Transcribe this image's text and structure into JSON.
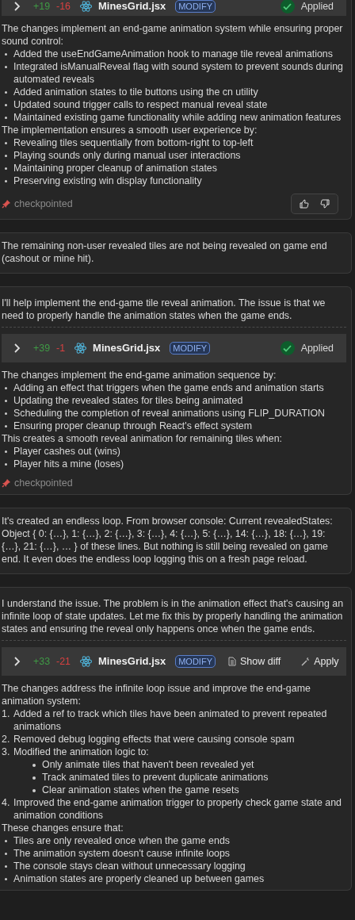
{
  "messages": [
    {
      "kind": "assistant",
      "cut_top": true,
      "file": {
        "added": "+19",
        "removed": "-16",
        "name": "MinesGrid.jsx",
        "badge": "MODIFY",
        "actions": [
          {
            "kind": "status",
            "label": "Applied"
          }
        ]
      },
      "body": [
        {
          "kind": "para",
          "text": "The changes implement an end-game animation system while ensuring proper sound control:"
        },
        {
          "kind": "bullets",
          "items": [
            {
              "text": "Added the useEndGameAnimation hook to manage tile reveal animations"
            },
            {
              "text": "Integrated isManualReveal flag with sound system to prevent sounds during automated reveals"
            },
            {
              "text": "Added animation states to tile buttons using the cn utility"
            },
            {
              "text": "Updated sound trigger calls to respect manual reveal state"
            },
            {
              "text": "Maintained existing game functionality while adding new animation features"
            }
          ]
        },
        {
          "kind": "para",
          "text": "The implementation ensures a smooth user experience by:"
        },
        {
          "kind": "bullets",
          "items": [
            {
              "text": "Revealing tiles sequentially from bottom-right to top-left"
            },
            {
              "text": "Playing sounds only during manual user interactions"
            },
            {
              "text": "Maintaining proper cleanup of animation states"
            },
            {
              "text": "Preserving existing win display functionality"
            }
          ]
        }
      ],
      "checkpoint": "checkpointed",
      "feedback": true
    },
    {
      "kind": "user",
      "text": "The remaining non-user revealed tiles are not being revealed on game end (cashout or mine hit)."
    },
    {
      "kind": "assistant",
      "intro": "I'll help implement the end-game tile reveal animation. The issue is that we need to properly handle the animation states when the game ends.",
      "file": {
        "added": "+39",
        "removed": "-1",
        "name": "MinesGrid.jsx",
        "badge": "MODIFY",
        "actions": [
          {
            "kind": "status",
            "label": "Applied"
          }
        ]
      },
      "body": [
        {
          "kind": "para",
          "text": "The changes implement the end-game animation sequence by:"
        },
        {
          "kind": "bullets",
          "items": [
            {
              "text": "Adding an effect that triggers when the game ends and animation starts"
            },
            {
              "text": "Updating the revealed states for tiles being animated"
            },
            {
              "text": "Scheduling the completion of reveal animations using FLIP_DURATION"
            },
            {
              "text": "Ensuring proper cleanup through React's effect system"
            }
          ]
        },
        {
          "kind": "para",
          "text": "This creates a smooth reveal animation for remaining tiles when:"
        },
        {
          "kind": "bullets",
          "items": [
            {
              "text": "Player cashes out (wins)"
            },
            {
              "text": "Player hits a mine (loses)"
            }
          ]
        }
      ],
      "checkpoint": "checkpointed"
    },
    {
      "kind": "user",
      "text": "It's created an endless loop. From browser console: Current revealedStates: Object { 0: {…}, 1: {…}, 2: {…}, 3: {…}, 4: {…}, 5: {…}, 14: {…}, 18: {…}, 19: {…}, 21: {…}, … } of these lines. But nothing is still being revealed on game end. It even does the endless loop logging this on a fresh page reload."
    },
    {
      "kind": "assistant",
      "intro": "I understand the issue. The problem is in the animation effect that's causing an infinite loop of state updates. Let me fix this by properly handling the animation states and ensuring the reveal only happens once when the game ends.",
      "file": {
        "added": "+33",
        "removed": "-21",
        "name": "MinesGrid.jsx",
        "badge": "MODIFY",
        "actions": [
          {
            "kind": "showdiff",
            "label": "Show diff"
          },
          {
            "kind": "apply",
            "label": "Apply"
          }
        ]
      },
      "body": [
        {
          "kind": "para",
          "text": "The changes address the infinite loop issue and improve the end-game animation system:"
        },
        {
          "kind": "numbered",
          "items": [
            {
              "number": "1.",
              "text": "Added a ref to track which tiles have been animated to prevent repeated animations"
            },
            {
              "number": "2.",
              "text": "Removed debug logging effects that were causing console spam"
            },
            {
              "number": "3.",
              "text": "Modified the animation logic to:",
              "children": [
                {
                  "text": "Only animate tiles that haven't been revealed yet"
                },
                {
                  "text": "Track animated tiles to prevent duplicate animations"
                },
                {
                  "text": "Clear animation states when the game resets"
                }
              ]
            },
            {
              "number": "4.",
              "text": "Improved the end-game animation trigger to properly check game state and animation conditions"
            }
          ]
        },
        {
          "kind": "para",
          "text": "These changes ensure that:"
        },
        {
          "kind": "bullets",
          "items": [
            {
              "text": "Tiles are only revealed once when the game ends"
            },
            {
              "text": "The animation system doesn't cause infinite loops"
            },
            {
              "text": "The console stays clean without unnecessary logging"
            },
            {
              "text": "Animation states are properly cleaned up between games"
            }
          ]
        }
      ]
    }
  ]
}
